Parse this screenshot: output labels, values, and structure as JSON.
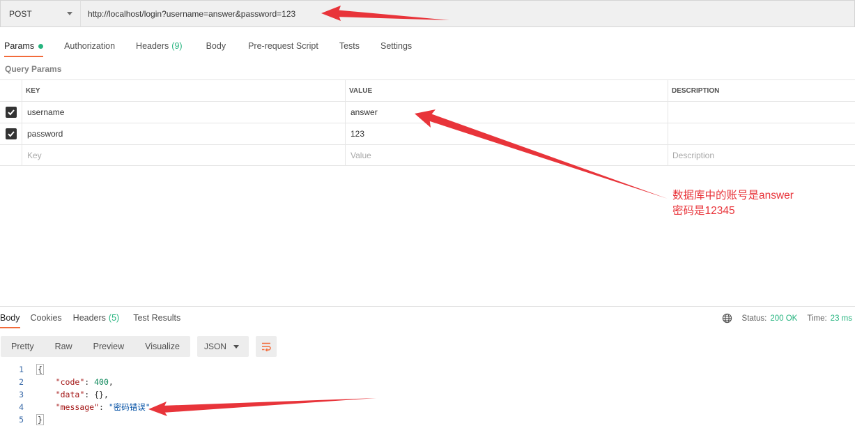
{
  "request": {
    "method": "POST",
    "url": "http://localhost/login?username=answer&password=123"
  },
  "request_tabs": [
    {
      "label": "Params",
      "active": true,
      "dot": true
    },
    {
      "label": "Authorization"
    },
    {
      "label": "Headers",
      "count": "(9)"
    },
    {
      "label": "Body"
    },
    {
      "label": "Pre-request Script"
    },
    {
      "label": "Tests"
    },
    {
      "label": "Settings"
    }
  ],
  "query_params": {
    "title": "Query Params",
    "headers": [
      "KEY",
      "VALUE",
      "DESCRIPTION"
    ],
    "rows": [
      {
        "checked": true,
        "key": "username",
        "value": "answer",
        "description": ""
      },
      {
        "checked": true,
        "key": "password",
        "value": "123",
        "description": ""
      }
    ],
    "placeholder": {
      "key": "Key",
      "value": "Value",
      "description": "Description"
    }
  },
  "annotation": {
    "line1": "数据库中的账号是answer",
    "line2": "密码是12345",
    "color": "#e8343a"
  },
  "response_tabs": [
    {
      "label": "Body",
      "active": true
    },
    {
      "label": "Cookies"
    },
    {
      "label": "Headers",
      "count": "(5)"
    },
    {
      "label": "Test Results"
    }
  ],
  "response_status": {
    "status_label": "Status:",
    "status_value": "200 OK",
    "time_label": "Time:",
    "time_value": "23 ms"
  },
  "response_view": {
    "modes": [
      "Pretty",
      "Raw",
      "Preview",
      "Visualize"
    ],
    "format": "JSON"
  },
  "response_body": {
    "lines": [
      "1",
      "2",
      "3",
      "4",
      "5"
    ],
    "code": 400,
    "code_key": "\"code\"",
    "data_key": "\"data\"",
    "data_value": "{}",
    "message_key": "\"message\"",
    "message_value": "\"密码错误\""
  },
  "colors": {
    "accent": "#f26b3a",
    "success": "#26b47f",
    "arrow": "#e8343a"
  }
}
